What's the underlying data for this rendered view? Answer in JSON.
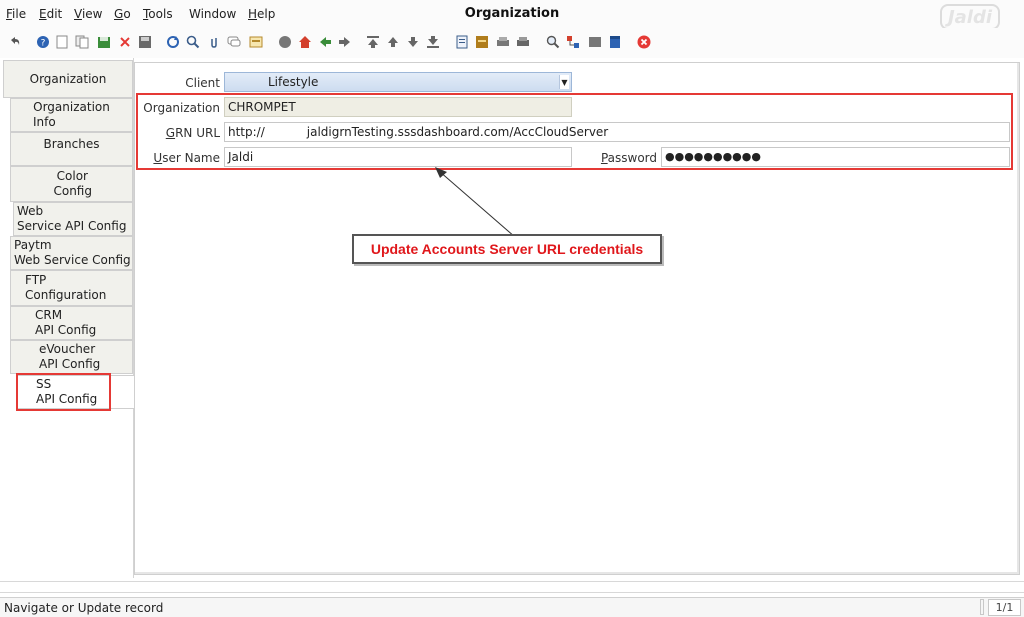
{
  "window": {
    "title": "Organization",
    "logo_text": "Jaldi"
  },
  "menu": [
    {
      "label": "File",
      "key": "F",
      "rest": "ile"
    },
    {
      "label": "Edit",
      "key": "E",
      "rest": "dit"
    },
    {
      "label": "View",
      "key": "V",
      "rest": "iew"
    },
    {
      "label": "Go",
      "key": "G",
      "rest": "o"
    },
    {
      "label": "Tools",
      "key": "T",
      "rest": "ools"
    },
    {
      "label": "Window",
      "key": "",
      "rest": "Window"
    },
    {
      "label": "Help",
      "key": "H",
      "rest": "elp"
    }
  ],
  "tabs": [
    {
      "lines": [
        "Organization"
      ]
    },
    {
      "lines": [
        "Organization",
        "Info"
      ]
    },
    {
      "lines": [
        "Branches"
      ]
    },
    {
      "lines": [
        "Color",
        "Config"
      ]
    },
    {
      "lines": [
        "Web",
        "Service API Config"
      ]
    },
    {
      "lines": [
        "Paytm",
        "Web Service Config"
      ]
    },
    {
      "lines": [
        "FTP",
        "Configuration"
      ]
    },
    {
      "lines": [
        "CRM",
        "API Config"
      ]
    },
    {
      "lines": [
        "eVoucher",
        "API Config"
      ]
    },
    {
      "lines": [
        "SS",
        "API Config"
      ]
    }
  ],
  "form": {
    "client_label": "Client",
    "client_value": "Lifestyle",
    "organization_label": "Organization",
    "organization_value": "CHROMPET",
    "grn_url_label_key": "G",
    "grn_url_label_rest": "RN URL",
    "grn_url_value_prefix": "http://",
    "grn_url_value_rest": "jaldigrnTesting.sssdashboard.com/AccCloudServer",
    "user_name_label_key": "U",
    "user_name_label_rest": "ser Name",
    "user_name_value": "Jaldi",
    "password_label_key": "P",
    "password_label_rest": "assword",
    "password_value": "●●●●●●●●●●"
  },
  "annotation": {
    "text": "Update Accounts Server URL credentials"
  },
  "status": {
    "message": "Navigate or Update record",
    "page_count": "1/1"
  },
  "colors": {
    "annotation_red": "#e53935",
    "annotation_text": "#e0171b",
    "client_select": "#cddcf0",
    "readonly_field": "#efeee4"
  }
}
